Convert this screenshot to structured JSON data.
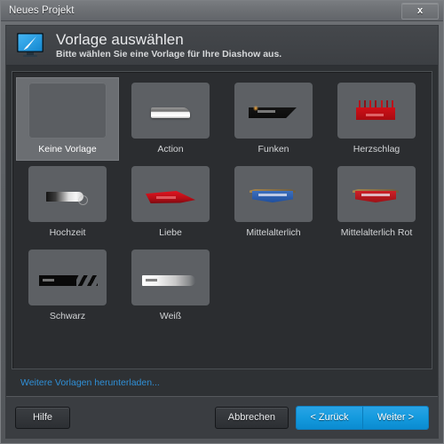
{
  "window": {
    "title": "Neues Projekt",
    "close_label": "x",
    "close_icon": "close-icon"
  },
  "header": {
    "icon": "monitor-paintbrush-icon",
    "title": "Vorlage auswählen",
    "subtitle": "Bitte wählen Sie eine Vorlage für Ihre Diashow aus."
  },
  "templates": [
    {
      "label": "Keine Vorlage",
      "art": "none",
      "selected": true
    },
    {
      "label": "Action",
      "art": "action",
      "selected": false
    },
    {
      "label": "Funken",
      "art": "funken",
      "selected": false
    },
    {
      "label": "Herzschlag",
      "art": "herzschlag",
      "selected": false
    },
    {
      "label": "Hochzeit",
      "art": "hochzeit",
      "selected": false
    },
    {
      "label": "Liebe",
      "art": "liebe",
      "selected": false
    },
    {
      "label": "Mittelalterlich",
      "art": "mittelalterlich",
      "selected": false
    },
    {
      "label": "Mittelalterlich Rot",
      "art": "mittelalterlich-rot",
      "selected": false
    },
    {
      "label": "Schwarz",
      "art": "schwarz",
      "selected": false
    },
    {
      "label": "Weiß",
      "art": "weiss",
      "selected": false
    }
  ],
  "links": {
    "download_more": "Weitere Vorlagen herunterladen..."
  },
  "footer": {
    "help": "Hilfe",
    "cancel": "Abbrechen",
    "back": "< Zurück",
    "next": "Weiter >"
  },
  "colors": {
    "accent_blue": "#149ade",
    "link_blue": "#2f8fd6",
    "window_chrome": "#5d6165",
    "panel_dark": "#2b2d30",
    "selected_tile": "#6b6e72"
  }
}
